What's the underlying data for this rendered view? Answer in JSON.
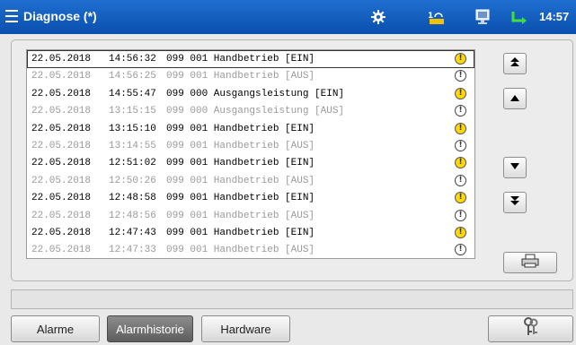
{
  "titlebar": {
    "title": "Diagnose (*)",
    "clock": "14:57",
    "icons": [
      "menu-icon",
      "settings-gear-icon",
      "operator-level-icon",
      "monitor-icon",
      "network-connection-icon"
    ],
    "accent_color": "#0a4fae"
  },
  "alarm_list": {
    "rows": [
      {
        "date": "22.05.2018",
        "time": "14:56:32",
        "message": "099 001 Handbetrieb [EIN]",
        "state": "active",
        "icon": "warning-active-icon"
      },
      {
        "date": "22.05.2018",
        "time": "14:56:25",
        "message": "099 001 Handbetrieb [AUS]",
        "state": "inactive",
        "icon": "warning-inactive-icon"
      },
      {
        "date": "22.05.2018",
        "time": "14:55:47",
        "message": "099 000 Ausgangsleistung [EIN]",
        "state": "active",
        "icon": "warning-active-icon"
      },
      {
        "date": "22.05.2018",
        "time": "13:15:15",
        "message": "099 000 Ausgangsleistung [AUS]",
        "state": "inactive",
        "icon": "warning-inactive-icon"
      },
      {
        "date": "22.05.2018",
        "time": "13:15:10",
        "message": "099 001 Handbetrieb [EIN]",
        "state": "active",
        "icon": "warning-active-icon"
      },
      {
        "date": "22.05.2018",
        "time": "13:14:55",
        "message": "099 001 Handbetrieb [AUS]",
        "state": "inactive",
        "icon": "warning-inactive-icon"
      },
      {
        "date": "22.05.2018",
        "time": "12:51:02",
        "message": "099 001 Handbetrieb [EIN]",
        "state": "active",
        "icon": "warning-active-icon"
      },
      {
        "date": "22.05.2018",
        "time": "12:50:26",
        "message": "099 001 Handbetrieb [AUS]",
        "state": "inactive",
        "icon": "warning-inactive-icon"
      },
      {
        "date": "22.05.2018",
        "time": "12:48:58",
        "message": "099 001 Handbetrieb [EIN]",
        "state": "active",
        "icon": "warning-active-icon"
      },
      {
        "date": "22.05.2018",
        "time": "12:48:56",
        "message": "099 001 Handbetrieb [AUS]",
        "state": "inactive",
        "icon": "warning-inactive-icon"
      },
      {
        "date": "22.05.2018",
        "time": "12:47:43",
        "message": "099 001 Handbetrieb [EIN]",
        "state": "active",
        "icon": "warning-active-icon"
      },
      {
        "date": "22.05.2018",
        "time": "12:47:33",
        "message": "099 001 Handbetrieb [AUS]",
        "state": "inactive",
        "icon": "warning-inactive-icon"
      }
    ],
    "active_color": "#ffd800",
    "inactive_text_color": "#9a9a9a"
  },
  "navigation": {
    "buttons": [
      "scroll-top-icon",
      "scroll-up-icon",
      "scroll-down-icon",
      "scroll-bottom-icon"
    ],
    "print_icon": "printer-icon"
  },
  "tabs": [
    {
      "label": "Alarme",
      "active": false
    },
    {
      "label": "Alarmhistorie",
      "active": true
    },
    {
      "label": "Hardware",
      "active": false
    }
  ],
  "login_icon": "keys-icon"
}
